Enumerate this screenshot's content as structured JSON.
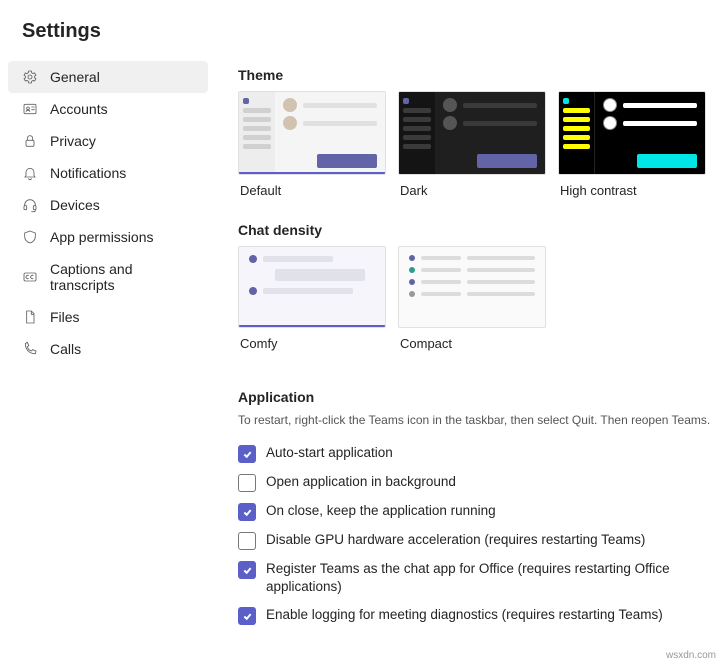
{
  "title": "Settings",
  "sidebar": {
    "items": [
      {
        "id": "general",
        "label": "General",
        "icon": "gear-icon",
        "active": true
      },
      {
        "id": "accounts",
        "label": "Accounts",
        "icon": "id-card-icon",
        "active": false
      },
      {
        "id": "privacy",
        "label": "Privacy",
        "icon": "lock-icon",
        "active": false
      },
      {
        "id": "notifications",
        "label": "Notifications",
        "icon": "bell-icon",
        "active": false
      },
      {
        "id": "devices",
        "label": "Devices",
        "icon": "headset-icon",
        "active": false
      },
      {
        "id": "app-permissions",
        "label": "App permissions",
        "icon": "shield-icon",
        "active": false
      },
      {
        "id": "captions",
        "label": "Captions and transcripts",
        "icon": "cc-icon",
        "active": false
      },
      {
        "id": "files",
        "label": "Files",
        "icon": "file-icon",
        "active": false
      },
      {
        "id": "calls",
        "label": "Calls",
        "icon": "phone-icon",
        "active": false
      }
    ]
  },
  "theme": {
    "heading": "Theme",
    "options": [
      {
        "id": "default",
        "label": "Default",
        "selected": true
      },
      {
        "id": "dark",
        "label": "Dark",
        "selected": false
      },
      {
        "id": "high-contrast",
        "label": "High contrast",
        "selected": false
      }
    ]
  },
  "density": {
    "heading": "Chat density",
    "options": [
      {
        "id": "comfy",
        "label": "Comfy",
        "selected": true
      },
      {
        "id": "compact",
        "label": "Compact",
        "selected": false
      }
    ]
  },
  "application": {
    "heading": "Application",
    "note": "To restart, right-click the Teams icon in the taskbar, then select Quit. Then reopen Teams.",
    "options": [
      {
        "id": "auto-start",
        "label": "Auto-start application",
        "checked": true
      },
      {
        "id": "open-bg",
        "label": "Open application in background",
        "checked": false
      },
      {
        "id": "on-close",
        "label": "On close, keep the application running",
        "checked": true
      },
      {
        "id": "disable-gpu",
        "label": "Disable GPU hardware acceleration (requires restarting Teams)",
        "checked": false
      },
      {
        "id": "register-chat",
        "label": "Register Teams as the chat app for Office (requires restarting Office applications)",
        "checked": true
      },
      {
        "id": "enable-logging",
        "label": "Enable logging for meeting diagnostics (requires restarting Teams)",
        "checked": true
      }
    ]
  },
  "watermark": "wsxdn.com"
}
